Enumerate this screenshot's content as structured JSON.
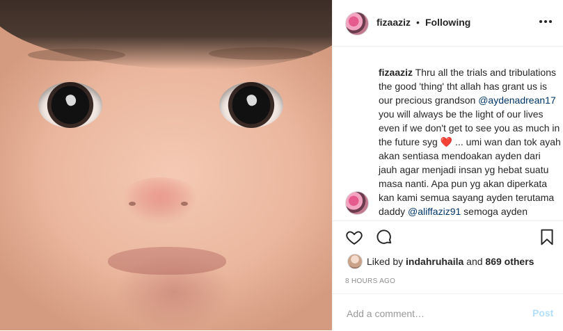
{
  "post": {
    "username": "fizaaziz",
    "separator": "•",
    "follow_status": "Following",
    "caption": {
      "username": "fizaaziz",
      "part1": " Thru all the trials and tribulations the good 'thing' tht allah has grant us is our precious grandson ",
      "mention1": "@aydenadrean17",
      "part2": " you will always be the light of our lives even if we don't get to see you as much in the future syg ",
      "emoji": "❤️",
      "part3": " ... umi wan dan tok ayah akan sentiasa mendoakan ayden dari jauh agar menjadi insan yg hebat suatu masa nanti. Apa pun yg akan diperkata kan kami semua sayang ayden terutama daddy ",
      "mention2": "@aliffaziz91",
      "part4": " semoga ayden"
    },
    "likes": {
      "prefix": "Liked by ",
      "liker": "indahruhaila",
      "middle": " and ",
      "others": "869 others"
    },
    "timestamp": "8 HOURS AGO",
    "comment_box": {
      "placeholder": "Add a comment…",
      "post_label": "Post"
    }
  },
  "icons": {
    "more": "more-horizontal-icon",
    "like": "heart-icon",
    "comment": "comment-icon",
    "save": "bookmark-icon"
  },
  "colors": {
    "text": "#262626",
    "mention": "#003569",
    "muted": "#8e8e8e",
    "post_disabled": "#b2dffc",
    "border": "#efefef"
  }
}
